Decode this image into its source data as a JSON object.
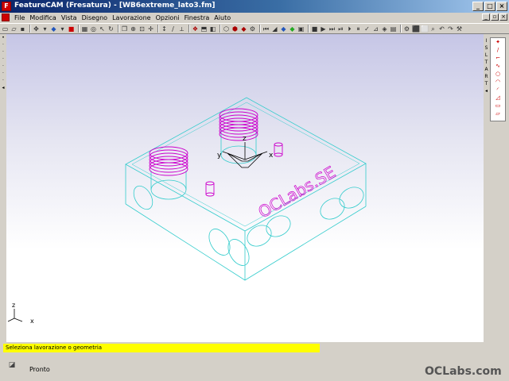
{
  "window": {
    "title": "FeatureCAM (Fresatura) - [WB6extreme_lato3.fm]",
    "app_icon": "F",
    "controls": [
      "_",
      "□",
      "×"
    ]
  },
  "menu": {
    "items": [
      "File",
      "Modifica",
      "Vista",
      "Disegno",
      "Lavorazione",
      "Opzioni",
      "Finestra",
      "Aiuto"
    ]
  },
  "viewport": {
    "axes_part": {
      "x": "x",
      "y": "y",
      "z": "z"
    },
    "axes_triad": {
      "x": "x",
      "z": "z"
    },
    "engraving_text": "OCLabs.SE",
    "colors": {
      "wire": "#33cccc",
      "feature": "#cc00cc",
      "background_top": "#c6c6e6"
    }
  },
  "message": {
    "text": "Seleziona lavorazione o geometria"
  },
  "status": {
    "text": "Pronto"
  },
  "watermark": "OCLabs.com"
}
